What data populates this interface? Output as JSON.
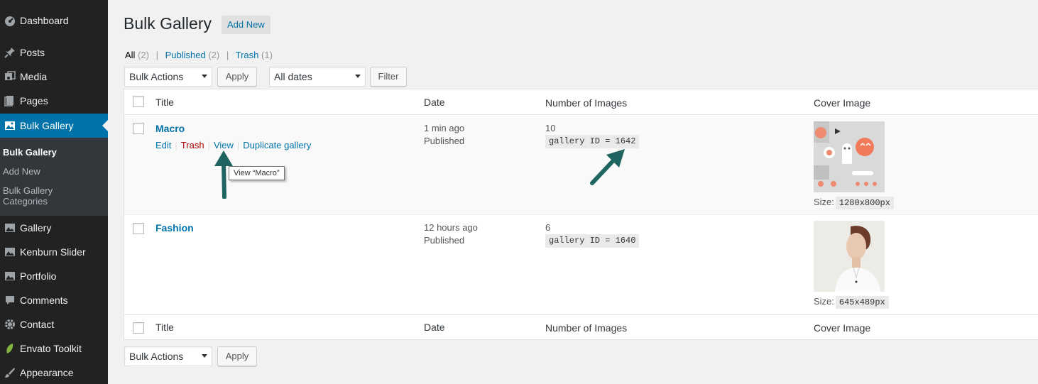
{
  "sidebar": {
    "items": [
      {
        "label": "Dashboard",
        "icon": "dashboard-icon"
      },
      {
        "label": "Posts",
        "icon": "pin-icon"
      },
      {
        "label": "Media",
        "icon": "media-icon"
      },
      {
        "label": "Pages",
        "icon": "pages-icon"
      },
      {
        "label": "Bulk Gallery",
        "icon": "gallery-icon",
        "active": true
      },
      {
        "label": "Gallery",
        "icon": "gallery-icon"
      },
      {
        "label": "Kenburn Slider",
        "icon": "gallery-icon"
      },
      {
        "label": "Portfolio",
        "icon": "gallery-icon"
      },
      {
        "label": "Comments",
        "icon": "comment-icon"
      },
      {
        "label": "Contact",
        "icon": "gear-icon"
      },
      {
        "label": "Envato Toolkit",
        "icon": "leaf-icon"
      },
      {
        "label": "Appearance",
        "icon": "brush-icon"
      }
    ],
    "submenu": [
      "Bulk Gallery",
      "Add New",
      "Bulk Gallery Categories"
    ]
  },
  "page": {
    "title": "Bulk Gallery",
    "add_new": "Add New"
  },
  "filters": {
    "all_label": "All",
    "all_count": "(2)",
    "published_label": "Published",
    "published_count": "(2)",
    "trash_label": "Trash",
    "trash_count": "(1)",
    "separator": "|"
  },
  "toolbar": {
    "bulk_actions": "Bulk Actions",
    "apply": "Apply",
    "dates": "All dates",
    "filter": "Filter"
  },
  "table": {
    "columns": [
      "Title",
      "Date",
      "Number of Images",
      "Cover Image"
    ],
    "rows": [
      {
        "title": "Macro",
        "actions": [
          "Edit",
          "Trash",
          "View",
          "Duplicate gallery"
        ],
        "date_rel": "1 min ago",
        "status": "Published",
        "count": "10",
        "gallery_id": "gallery ID = 1642",
        "size_label": "Size:",
        "size": "1280x800px"
      },
      {
        "title": "Fashion",
        "date_rel": "12 hours ago",
        "status": "Published",
        "count": "6",
        "gallery_id": "gallery ID = 1640",
        "size_label": "Size:",
        "size": "645x489px"
      }
    ]
  },
  "tooltip": "View “Macro”",
  "colors": {
    "sidebar_bg": "#222222",
    "active_bg": "#0073aa",
    "link": "#0073aa",
    "trash": "#aa0000",
    "arrow": "#1e6461"
  }
}
